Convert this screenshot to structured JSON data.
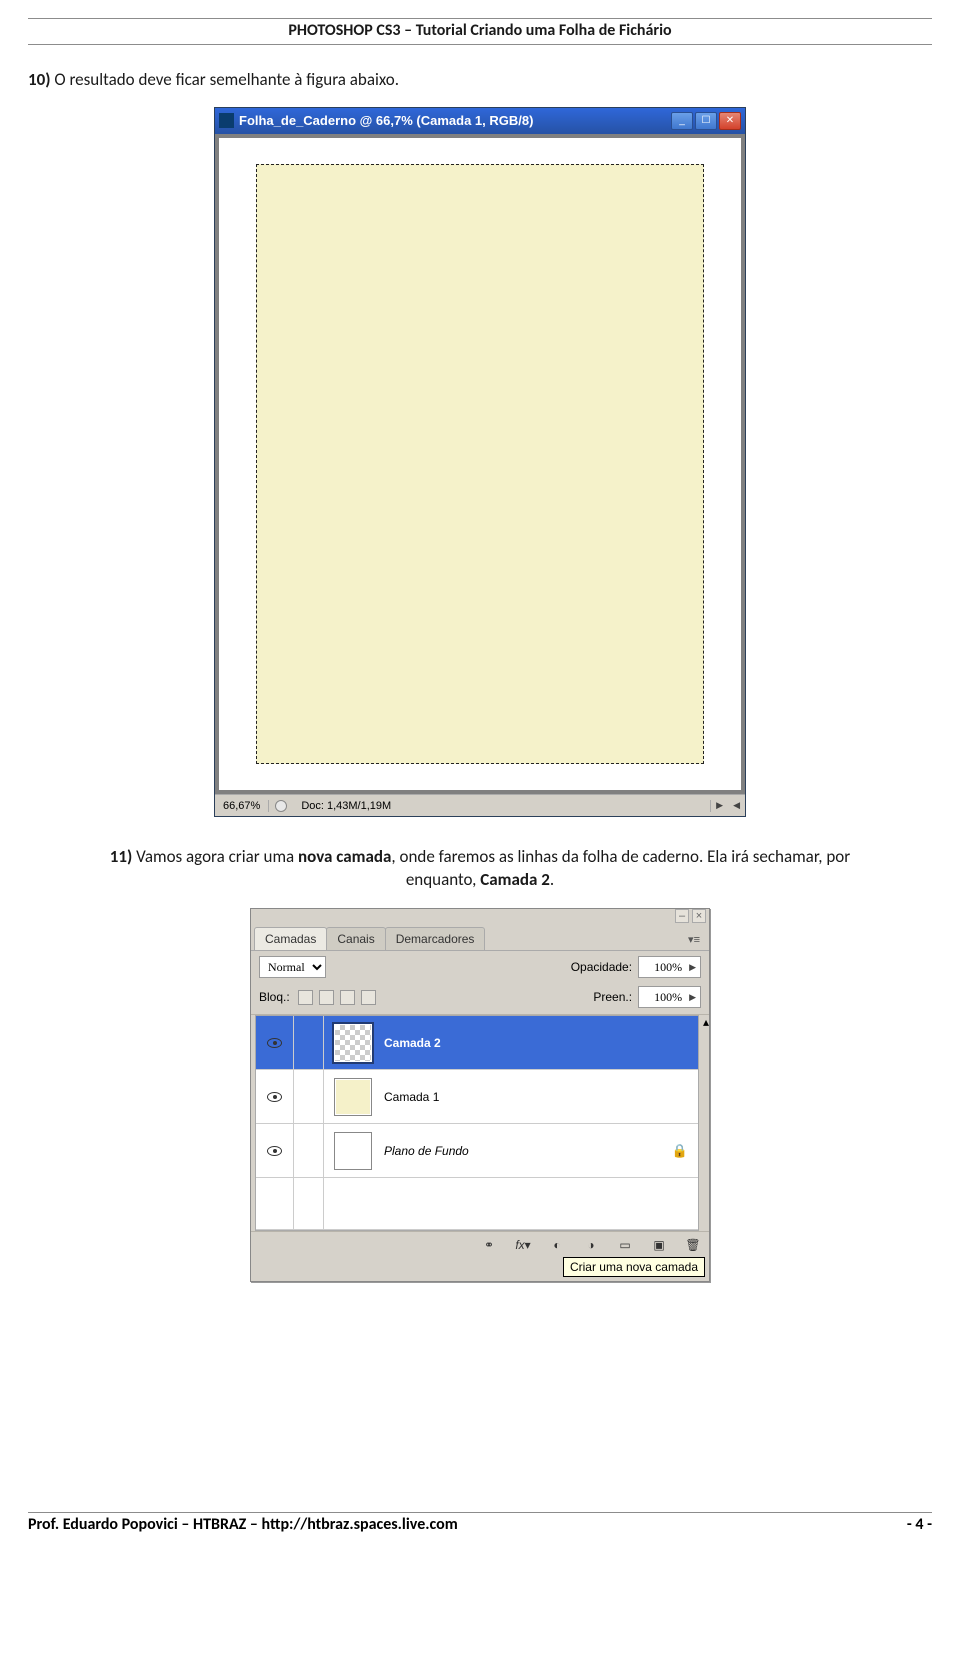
{
  "header": {
    "title": "PHOTOSHOP CS3 – Tutorial Criando uma Folha de Fichário"
  },
  "step10": {
    "num": "10)",
    "text": " O resultado deve ficar semelhante à figura abaixo."
  },
  "ps_window": {
    "title": "Folha_de_Caderno @ 66,7% (Camada 1, RGB/8)",
    "zoom": "66,67%",
    "docinfo": "Doc: 1,43M/1,19M"
  },
  "step11": {
    "num": "11)",
    "pre": " Vamos agora criar uma ",
    "bold1": "nova camada",
    "mid": ", onde faremos as linhas da folha de caderno. Ela irá sechamar, por",
    "line2_pre": "enquanto, ",
    "bold2": "Camada 2",
    "line2_post": "."
  },
  "layers_panel": {
    "tabs": [
      "Camadas",
      "Canais",
      "Demarcadores"
    ],
    "mode": "Normal",
    "opacity_label": "Opacidade:",
    "opacity_value": "100%",
    "lock_label": "Bloq.:",
    "fill_label": "Preen.:",
    "fill_value": "100%",
    "layers": [
      {
        "name": "Camada 2"
      },
      {
        "name": "Camada 1"
      },
      {
        "name": "Plano de Fundo"
      }
    ],
    "tooltip": "Criar uma nova camada"
  },
  "footer": {
    "left": "Prof. Eduardo Popovici – HTBRAZ – http://htbraz.spaces.live.com",
    "right": "- 4 -"
  }
}
